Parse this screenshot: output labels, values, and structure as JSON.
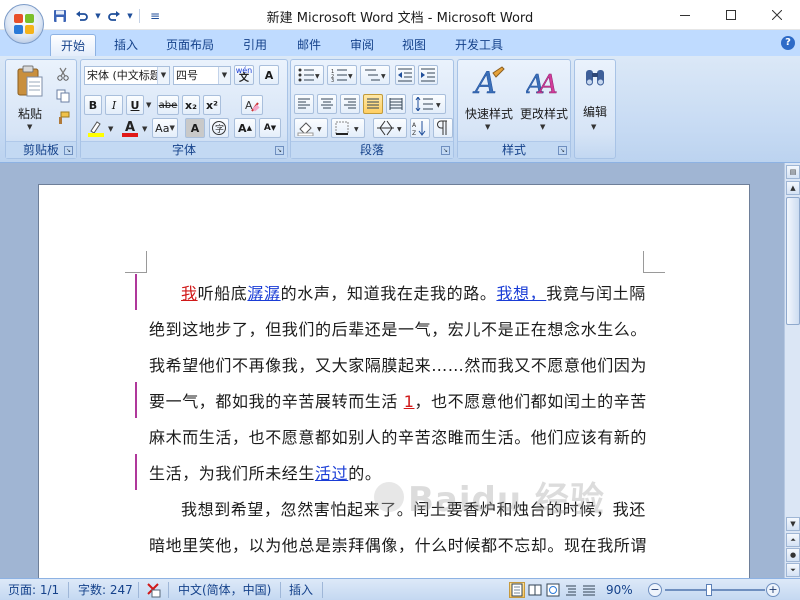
{
  "app": {
    "title": "新建 Microsoft Word 文档 - Microsoft Word",
    "qat": {
      "customize_glyph": "≡"
    }
  },
  "tabs": [
    "开始",
    "插入",
    "页面布局",
    "引用",
    "邮件",
    "审阅",
    "视图",
    "开发工具"
  ],
  "active_tab": "开始",
  "ribbon": {
    "clipboard": {
      "label": "剪贴板",
      "paste": "粘贴"
    },
    "font": {
      "label": "字体",
      "font_name": "宋体 (中文标题",
      "font_size": "四号",
      "bold": "B",
      "italic": "I",
      "underline": "U",
      "strike": "abe",
      "subscript": "x₂",
      "superscript": "x²",
      "grow": "A",
      "shrink": "A",
      "change_case": "Aa",
      "clear": "A",
      "phonetic": "wén"
    },
    "paragraph": {
      "label": "段落"
    },
    "styles": {
      "label": "样式",
      "quick_styles": "快速样式",
      "change_styles": "更改样式"
    },
    "editing": {
      "label": "编辑"
    }
  },
  "document": {
    "lines": [
      {
        "parts": [
          {
            "t": "我",
            "s": "red"
          },
          {
            "t": "听船底"
          },
          {
            "t": "潺潺",
            "s": "blue"
          },
          {
            "t": "的水声，知道我在走我的路。"
          },
          {
            "t": "我想，",
            "s": "blue"
          },
          {
            "t": "我竟与闰土隔"
          }
        ],
        "indent": true
      },
      {
        "parts": [
          {
            "t": "绝到这地步了，但我们的后辈还是一气，宏儿不是正在想念水生么。"
          }
        ]
      },
      {
        "parts": [
          {
            "t": "我希望他们不再像我，又大家隔膜起来……然而我又不愿意他们因为"
          }
        ]
      },
      {
        "parts": [
          {
            "t": "要一气，都如我的辛苦展转而生活 "
          },
          {
            "t": "1",
            "s": "red"
          },
          {
            "t": "，也不愿意他们都如闰土的辛苦"
          }
        ]
      },
      {
        "parts": [
          {
            "t": "麻木而生活，也不愿意都如别人的辛苦恣睢而生活。他们应该有新的"
          }
        ]
      },
      {
        "parts": [
          {
            "t": "生活，为我们所未经生"
          },
          {
            "t": "活过",
            "s": "blue"
          },
          {
            "t": "的。"
          }
        ]
      },
      {
        "parts": [
          {
            "t": "我想到希望，忽然害怕起来了。闰土要香炉和烛台的时候，我还"
          }
        ],
        "indent": true
      },
      {
        "parts": [
          {
            "t": "暗地里笑他，以为他总是崇拜偶像，什么时候都不忘却。现在我所谓"
          }
        ]
      }
    ],
    "watermark": "Baidu 经验"
  },
  "statusbar": {
    "page": "页面: 1/1",
    "words": "字数: 247",
    "language": "中文(简体，中国)",
    "mode": "插入",
    "zoom": "90%",
    "zoom_value": 0.9
  },
  "colors": {
    "revision_mark": "#b0389b",
    "red_mark": "#d01818",
    "blue_mark": "#1a3dd6",
    "ribbon_text": "#15428b"
  }
}
